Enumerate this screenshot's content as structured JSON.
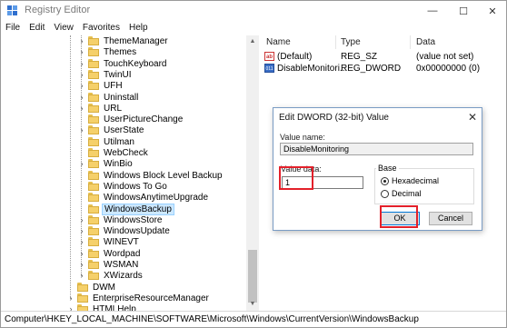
{
  "window": {
    "title": "Registry Editor",
    "controls": {
      "minimize": "—",
      "maximize": "☐",
      "close": "✕"
    }
  },
  "menu": [
    "File",
    "Edit",
    "View",
    "Favorites",
    "Help"
  ],
  "tree": {
    "items": [
      {
        "label": "ThemeManager",
        "expandable": true
      },
      {
        "label": "Themes",
        "expandable": true
      },
      {
        "label": "TouchKeyboard",
        "expandable": true
      },
      {
        "label": "TwinUI",
        "expandable": true
      },
      {
        "label": "UFH",
        "expandable": true
      },
      {
        "label": "Uninstall",
        "expandable": true
      },
      {
        "label": "URL",
        "expandable": true
      },
      {
        "label": "UserPictureChange",
        "expandable": false
      },
      {
        "label": "UserState",
        "expandable": true
      },
      {
        "label": "Utilman",
        "expandable": false
      },
      {
        "label": "WebCheck",
        "expandable": false
      },
      {
        "label": "WinBio",
        "expandable": true
      },
      {
        "label": "Windows Block Level Backup",
        "expandable": false
      },
      {
        "label": "Windows To Go",
        "expandable": false
      },
      {
        "label": "WindowsAnytimeUpgrade",
        "expandable": false
      },
      {
        "label": "WindowsBackup",
        "expandable": false,
        "selected": true
      },
      {
        "label": "WindowsStore",
        "expandable": true
      },
      {
        "label": "WindowsUpdate",
        "expandable": true
      },
      {
        "label": "WINEVT",
        "expandable": true
      },
      {
        "label": "Wordpad",
        "expandable": true
      },
      {
        "label": "WSMAN",
        "expandable": true
      },
      {
        "label": "XWizards",
        "expandable": true
      }
    ],
    "parent_items": [
      {
        "label": "DWM",
        "expandable": false
      },
      {
        "label": "EnterpriseResourceManager",
        "expandable": true
      },
      {
        "label": "HTMLHelp",
        "expandable": true
      }
    ]
  },
  "list": {
    "columns": [
      "Name",
      "Type",
      "Data"
    ],
    "rows": [
      {
        "icon": "string-value-icon",
        "icon_text": "ab",
        "name": "(Default)",
        "type": "REG_SZ",
        "data": "(value not set)"
      },
      {
        "icon": "dword-value-icon",
        "icon_text": "011",
        "name": "DisableMonitori...",
        "type": "REG_DWORD",
        "data": "0x00000000 (0)"
      }
    ]
  },
  "status_bar": "Computer\\HKEY_LOCAL_MACHINE\\SOFTWARE\\Microsoft\\Windows\\CurrentVersion\\WindowsBackup",
  "dialog": {
    "title": "Edit DWORD (32-bit) Value",
    "close": "✕",
    "value_name_label": "Value name:",
    "value_name": "DisableMonitoring",
    "value_data_label": "Value data:",
    "value_data": "1",
    "base_label": "Base",
    "hex_label": "Hexadecimal",
    "dec_label": "Decimal",
    "selected_base": "Hexadecimal",
    "ok_label": "OK",
    "cancel_label": "Cancel"
  },
  "colors": {
    "highlight": "#e3202a",
    "selection": "#cce8ff",
    "folder": "#f5d06a"
  }
}
